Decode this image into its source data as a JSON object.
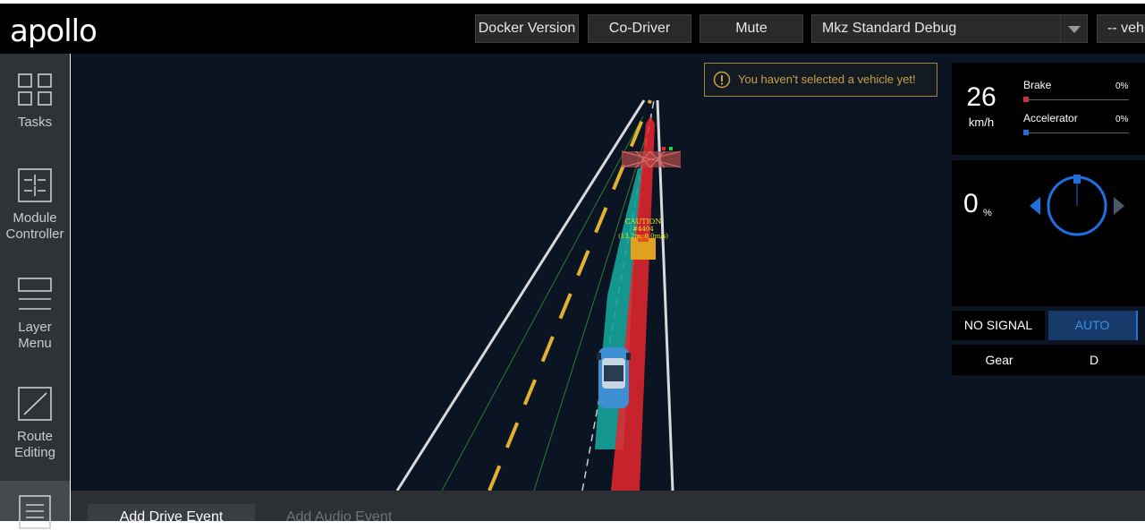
{
  "header": {
    "logo": "apollo",
    "docker_button": "Docker Version",
    "codriver_button": "Co-Driver",
    "mute_button": "Mute",
    "mode_select": "Mkz Standard Debug",
    "vehicle_select": "-- vehicle --"
  },
  "sidebar": {
    "items": [
      {
        "label": "Tasks",
        "icon": "tasks-icon"
      },
      {
        "label": "Module Controller",
        "icon": "module-controller-icon"
      },
      {
        "label": "Layer Menu",
        "icon": "layer-menu-icon"
      },
      {
        "label": "Route Editing",
        "icon": "route-editing-icon"
      },
      {
        "label": "",
        "icon": "data-recorder-icon"
      }
    ]
  },
  "scene": {
    "notification": "You haven't selected a vehicle yet!",
    "obstacle_caution": "CAUTION",
    "obstacle_id": "#4404",
    "obstacle_info": "(13.2m, 0.0m/s)"
  },
  "dashboard": {
    "speed": "26",
    "speed_unit": "km/h",
    "brake_label": "Brake",
    "brake_pct": "0%",
    "brake_value": 0,
    "accelerator_label": "Accelerator",
    "accelerator_pct": "0%",
    "accelerator_value": 0,
    "steering_value": "0",
    "steering_unit": "%",
    "signal_label": "NO SIGNAL",
    "drive_mode": "AUTO",
    "gear_label": "Gear",
    "gear_value": "D"
  },
  "bottom": {
    "tab_drive_event": "Add Drive Event",
    "tab_audio_event": "Add Audio Event"
  },
  "colors": {
    "background": "#0b1422",
    "brake": "#c0393c",
    "accelerator": "#1e6fe0",
    "auto_mode": "#173a6a",
    "planning": "#15a39a",
    "reference_line": "#e8262e",
    "lane_divider": "#e0b233",
    "notice_border": "#a08440"
  }
}
